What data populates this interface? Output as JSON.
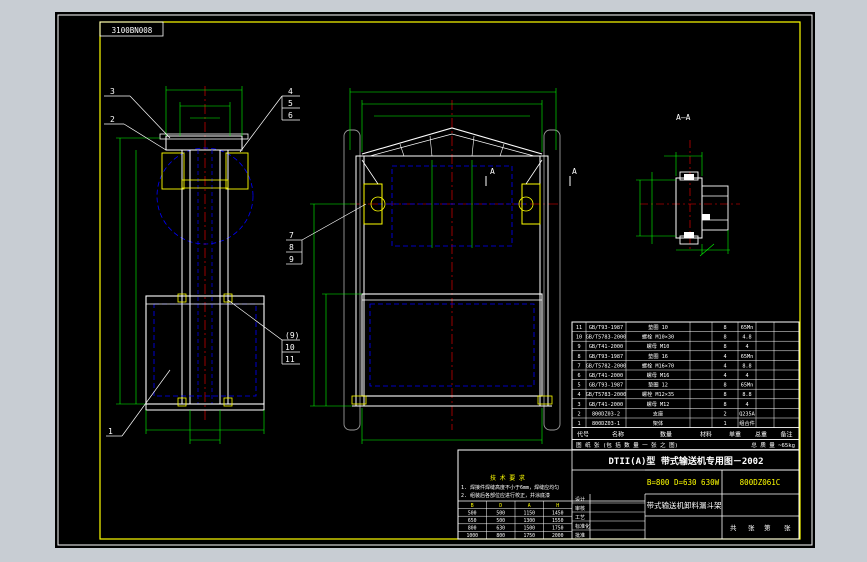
{
  "drawing_code": "DTII(A)型  带式输送机专用图－2002",
  "corner_tag": "3100BN008",
  "section_label": "A—A",
  "section_marks": [
    "A",
    "A"
  ],
  "left_part_numbers": [
    "3",
    "2",
    "4",
    "5",
    "6",
    "1",
    "(9)",
    "10",
    "11"
  ],
  "middle_part_numbers": [
    "7",
    "8",
    "9"
  ],
  "bom": {
    "header": [
      "代号",
      "名称",
      "数量",
      "材料",
      "单重",
      "总重",
      "备注"
    ],
    "rows": [
      [
        "11",
        "GB/T93-1987",
        "垫圈 10",
        "8",
        "65Mn",
        "",
        ""
      ],
      [
        "10",
        "GB/T5783-2000",
        "螺栓 M10×30",
        "8",
        "4.8",
        "",
        ""
      ],
      [
        "9",
        "GB/T41-2000",
        "螺母 M10",
        "8",
        "4",
        "",
        ""
      ],
      [
        "8",
        "GB/T93-1987",
        "垫圈 16",
        "4",
        "65Mn",
        "",
        ""
      ],
      [
        "7",
        "GB/T5782-2000",
        "螺栓 M16×70",
        "4",
        "8.8",
        "",
        ""
      ],
      [
        "6",
        "GB/T41-2000",
        "螺母 M16",
        "4",
        "4",
        "",
        ""
      ],
      [
        "5",
        "GB/T93-1987",
        "垫圈 12",
        "8",
        "65Mn",
        "",
        ""
      ],
      [
        "4",
        "GB/T5783-2000",
        "螺栓 M12×35",
        "8",
        "8.8",
        "",
        ""
      ],
      [
        "3",
        "GB/T41-2000",
        "螺母 M12",
        "8",
        "4",
        "",
        ""
      ],
      [
        "2",
        "800DZ03-2",
        "支座",
        "2",
        "Q235A",
        "",
        ""
      ],
      [
        "1",
        "800DZ03-1",
        "架体",
        "1",
        "组合件",
        "",
        ""
      ]
    ],
    "footer_left": "图 纸 张 (包 括 数 量  一 张  之 图)",
    "footer_right": "总 质 量  ~65kg"
  },
  "spec_line": "B=800 D=630 630W",
  "spec_code": "800DZ061C",
  "drawing_title": "带式输送机卸料漏斗架",
  "notes": {
    "heading": "技 术 要 求",
    "lines": [
      "1. 焊接件焊缝高度不小于6mm，焊缝应均匀",
      "2. 组装后各部位应进行校正，并涂底漆"
    ]
  },
  "param_table": {
    "header": [
      "B",
      "D",
      "A",
      "H"
    ],
    "rows": [
      [
        "500",
        "500",
        "1150",
        "1450"
      ],
      [
        "650",
        "500",
        "1300",
        "1550"
      ],
      [
        "800",
        "630",
        "1500",
        "1750"
      ],
      [
        "1000",
        "800",
        "1750",
        "2000"
      ]
    ]
  },
  "approval_labels": [
    "设计",
    "审核",
    "工艺",
    "标准化",
    "批准"
  ],
  "sheet_labels": [
    "共",
    "张",
    "第",
    "张"
  ],
  "colors": {
    "paper": "#000000",
    "chrome": "#c8cdd3",
    "border": "#ffff00",
    "geometry": "#ffffff",
    "hidden": "#0000ff",
    "dims": "#00ff00",
    "centerline": "#ff0000",
    "text": "#ffffff",
    "accent": "#ffff00"
  }
}
